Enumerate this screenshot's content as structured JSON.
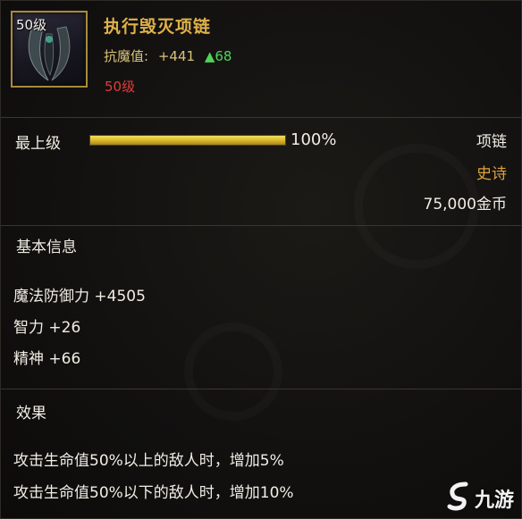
{
  "item": {
    "level_badge": "50级",
    "name": "执行毁灭项链",
    "stat_label": "抗魔值:",
    "stat_value": "+441",
    "stat_gain": "▲68",
    "required_level": "50级"
  },
  "upgrade": {
    "label": "最上级",
    "progress": 1.0,
    "percent_text": "100%"
  },
  "meta": {
    "slot": "项链",
    "rarity": "史诗",
    "price": "75,000金币"
  },
  "basic_info": {
    "title": "基本信息",
    "attributes": [
      "魔法防御力 +4505",
      "智力 +26",
      "精神 +66"
    ]
  },
  "effects": {
    "title": "效果",
    "lines": [
      "攻击生命值50%以上的敌人时，增加5%",
      "攻击生命值50%以下的敌人时，增加10%"
    ]
  },
  "watermark": {
    "text": "九游",
    "icon": "jiuyou-logo-icon"
  },
  "colors": {
    "name": "#e0b14a",
    "stat_gain": "#52d25a",
    "required_level": "#e23b3b",
    "rarity": "#e0a23a",
    "frame": "#a88a3c"
  }
}
